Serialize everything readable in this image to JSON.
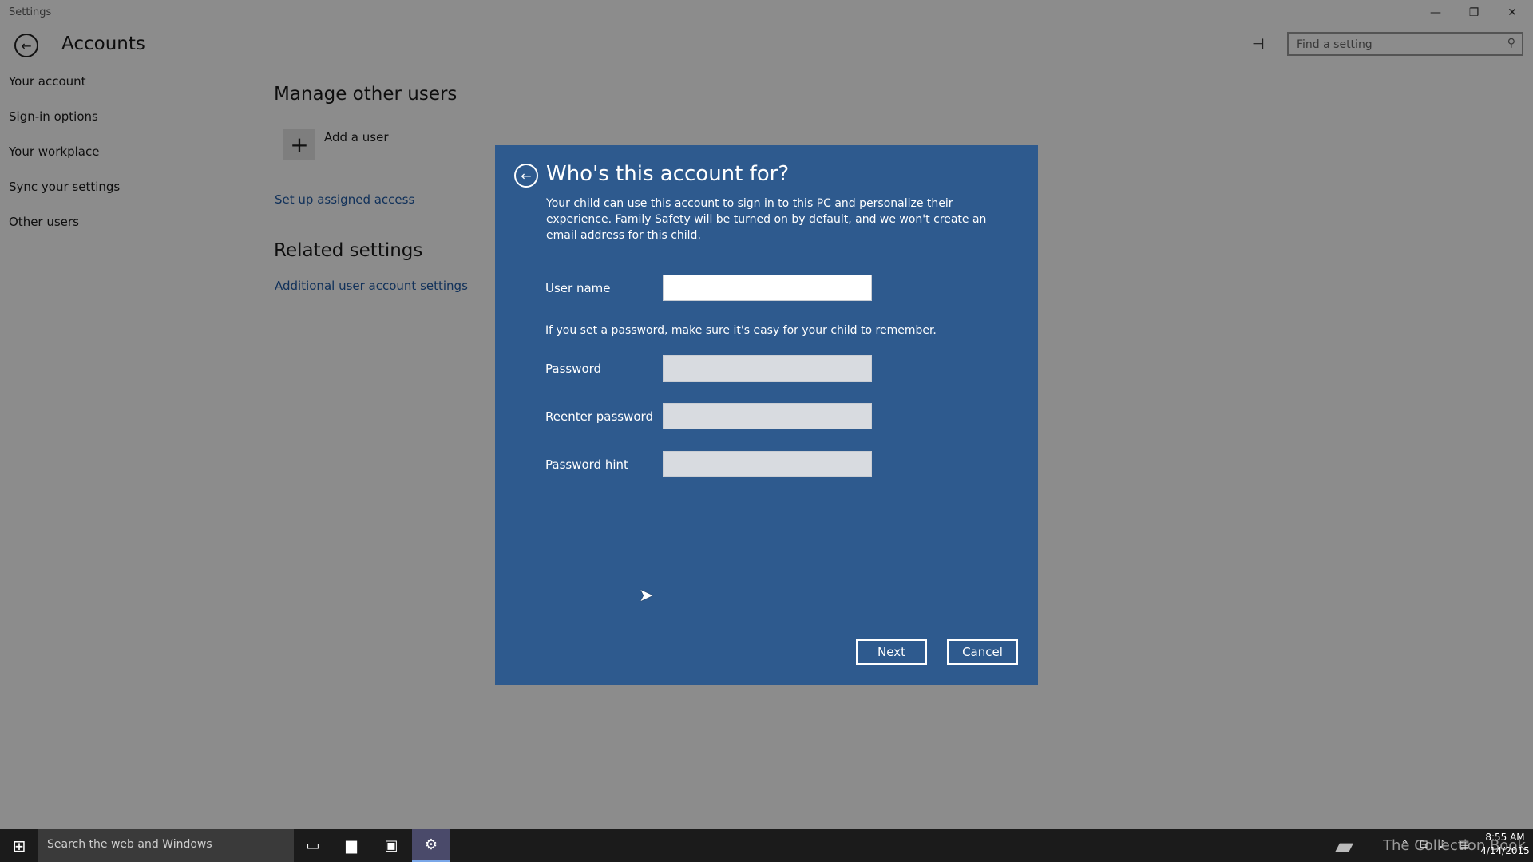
{
  "window": {
    "title": "Settings",
    "minimize_glyph": "—",
    "restore_glyph": "❐",
    "close_glyph": "✕"
  },
  "header": {
    "page_title": "Accounts",
    "search_placeholder": "Find a setting"
  },
  "sidebar": {
    "items": [
      {
        "label": "Your account"
      },
      {
        "label": "Sign-in options"
      },
      {
        "label": "Your workplace"
      },
      {
        "label": "Sync your settings"
      },
      {
        "label": "Other users"
      }
    ]
  },
  "content": {
    "manage_title": "Manage other users",
    "add_user_label": "Add a user",
    "assigned_access_link": "Set up assigned access",
    "related_title": "Related settings",
    "additional_link": "Additional user account settings"
  },
  "dialog": {
    "title": "Who's this account for?",
    "description": "Your child can use this account to sign in to this PC and personalize their experience. Family Safety will be turned on by default, and we won't create an email address for this child.",
    "username_label": "User name",
    "username_value": "",
    "password_note": "If you set a password, make sure it's easy for your child to remember.",
    "password_label": "Password",
    "reenter_label": "Reenter password",
    "hint_label": "Password hint",
    "next_label": "Next",
    "cancel_label": "Cancel",
    "accent_color": "#2e5a8e"
  },
  "taskbar": {
    "search_text": "Search the web and Windows",
    "watermark_text": "The Collection Book",
    "clock_time": "8:55 AM",
    "clock_date": "4/14/2015"
  }
}
